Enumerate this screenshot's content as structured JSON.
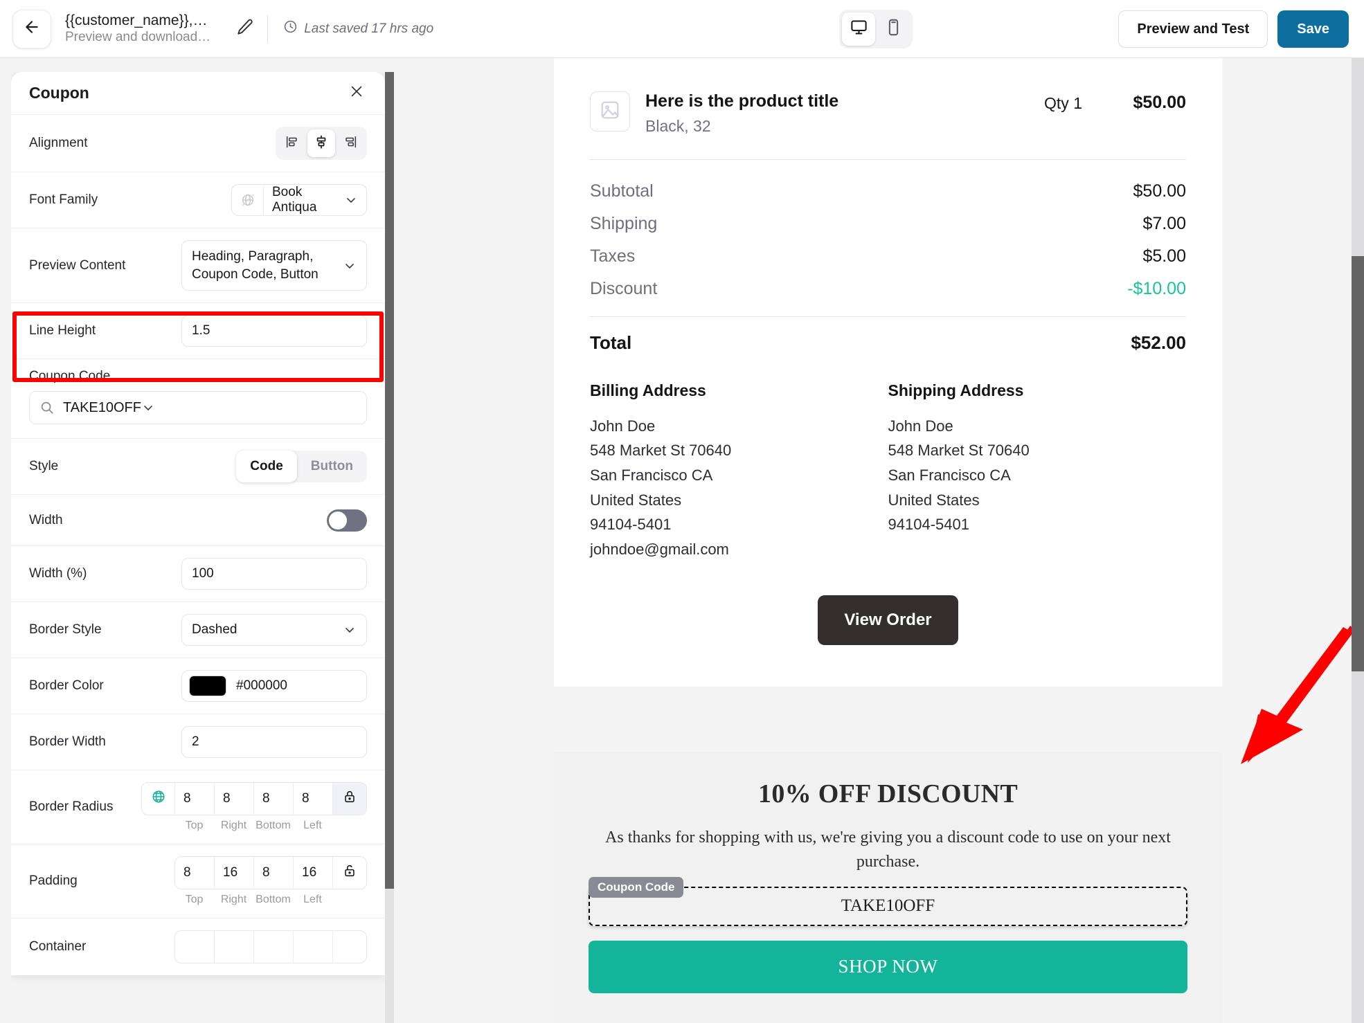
{
  "topbar": {
    "back_icon": "arrow-left-icon",
    "doc_title": "{{customer_name}},…",
    "doc_subtitle": "Preview and download…",
    "edit_icon": "pencil-icon",
    "saved_icon": "clock-icon",
    "saved_text": "Last saved 17 hrs ago",
    "device_desktop": "desktop-icon",
    "device_mobile": "mobile-icon",
    "preview_label": "Preview and Test",
    "save_label": "Save",
    "primary_color": "#0d6ea0"
  },
  "panel": {
    "title": "Coupon",
    "close_icon": "close-icon",
    "alignment": {
      "label": "Alignment",
      "options": [
        "align-left-icon",
        "align-center-icon",
        "align-right-icon"
      ],
      "selected": "align-center-icon"
    },
    "font_family": {
      "label": "Font Family",
      "value": "Book Antiqua",
      "globe_icon": "globe-disabled-icon",
      "chevron": "chevron-down-icon"
    },
    "preview_content": {
      "label": "Preview Content",
      "value": "Heading, Paragraph, Coupon Code, Button",
      "chevron": "chevron-down-icon"
    },
    "line_height": {
      "label": "Line Height",
      "value": "1.5"
    },
    "coupon_code": {
      "label": "Coupon Code",
      "value": "TAKE10OFF",
      "search_icon": "search-icon",
      "chevron": "chevron-down-icon",
      "highlight_color": "#ff0000"
    },
    "style": {
      "label": "Style",
      "options": [
        "Code",
        "Button"
      ],
      "selected": "Code"
    },
    "width_toggle": {
      "label": "Width",
      "state": "off"
    },
    "width_pct": {
      "label": "Width (%)",
      "value": "100"
    },
    "border_style": {
      "label": "Border Style",
      "value": "Dashed",
      "chevron": "chevron-down-icon"
    },
    "border_color": {
      "label": "Border Color",
      "value": "#000000",
      "swatch": "#000000"
    },
    "border_width": {
      "label": "Border Width",
      "value": "2"
    },
    "border_radius": {
      "label": "Border Radius",
      "globe_icon": "globe-icon",
      "globe_color": "#16b49a",
      "values": [
        "8",
        "8",
        "8",
        "8"
      ],
      "side_labels": [
        "Top",
        "Right",
        "Bottom",
        "Left"
      ],
      "lock_icon": "lock-closed-icon",
      "lock_state": "locked"
    },
    "padding": {
      "label": "Padding",
      "values": [
        "8",
        "16",
        "8",
        "16"
      ],
      "side_labels": [
        "Top",
        "Right",
        "Bottom",
        "Left"
      ],
      "lock_icon": "lock-open-icon",
      "lock_state": "unlocked"
    },
    "container": {
      "label": "Container"
    }
  },
  "preview": {
    "product": {
      "image_icon": "image-placeholder-icon",
      "title": "Here is the product title",
      "variant": "Black, 32",
      "qty": "Qty 1",
      "price": "$50.00"
    },
    "totals": [
      {
        "label": "Subtotal",
        "value": "$50.00",
        "accent": false
      },
      {
        "label": "Shipping",
        "value": "$7.00",
        "accent": false
      },
      {
        "label": "Taxes",
        "value": "$5.00",
        "accent": false
      },
      {
        "label": "Discount",
        "value": "-$10.00",
        "accent": true
      }
    ],
    "total": {
      "label": "Total",
      "value": "$52.00"
    },
    "billing": {
      "title": "Billing Address",
      "lines": [
        "John Doe",
        "548 Market St 70640",
        "San Francisco CA",
        "United States",
        "94104-5401",
        "johndoe@gmail.com"
      ]
    },
    "shipping": {
      "title": "Shipping Address",
      "lines": [
        "John Doe",
        "548 Market St 70640",
        "San Francisco CA",
        "United States",
        "94104-5401"
      ]
    },
    "view_order_label": "View Order",
    "promo": {
      "heading": "10% OFF DISCOUNT",
      "paragraph": "As thanks for shopping with us, we're giving you a discount code to use on your next purchase.",
      "coupon_tag": "Coupon Code",
      "coupon_value": "TAKE10OFF",
      "cta_label": "SHOP NOW",
      "cta_color": "#13b49a"
    }
  },
  "annotation": {
    "arrow_color": "#ff0000",
    "arrow_icon": "red-arrow-pointer"
  }
}
